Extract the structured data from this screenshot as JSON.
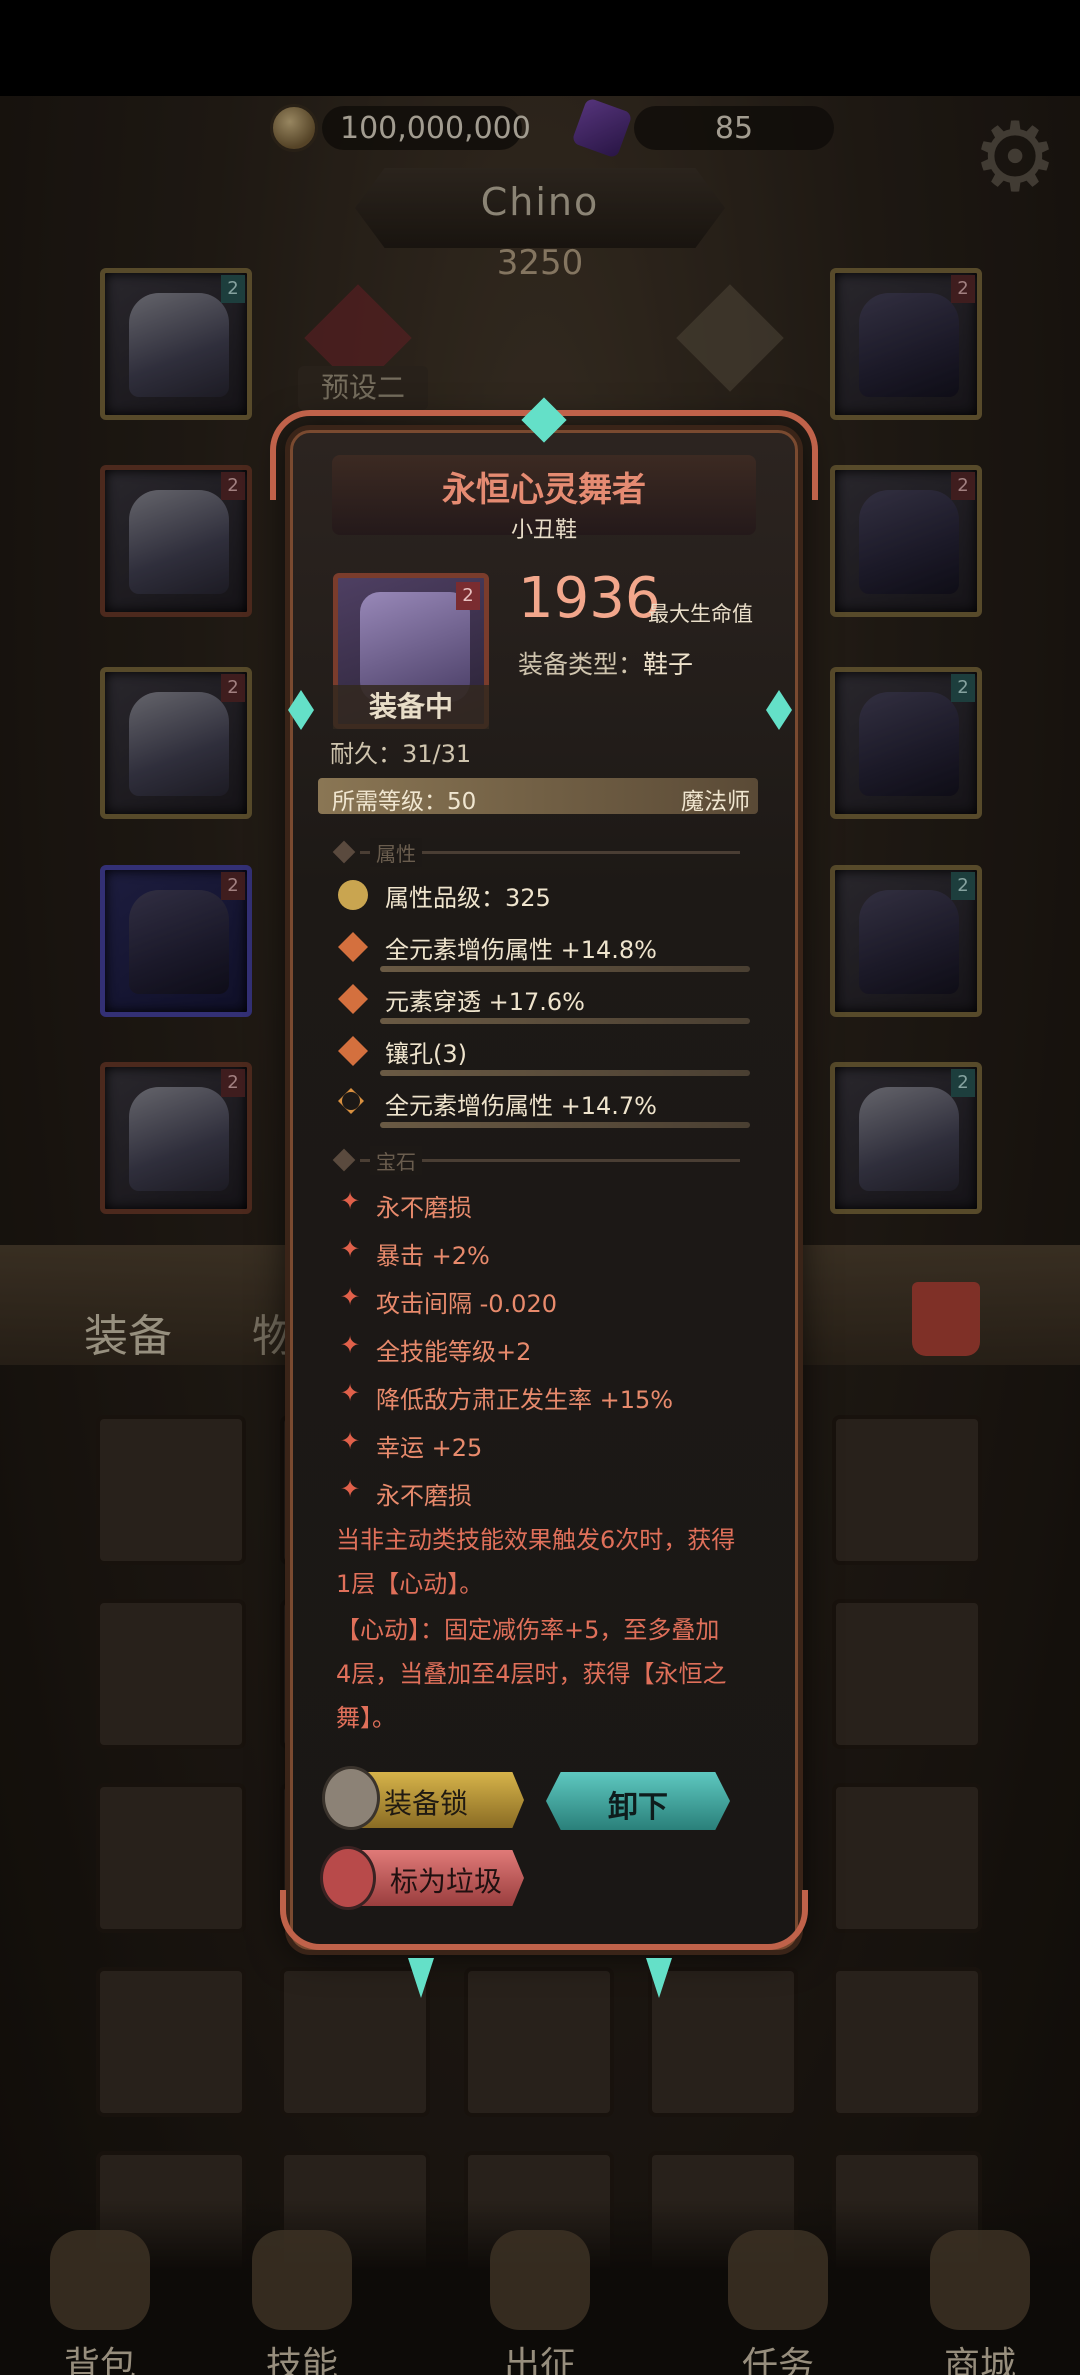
{
  "currency": {
    "gold": "100,000,000",
    "gems": "85"
  },
  "character": {
    "name": "Chino",
    "power": "3250",
    "preset": "预设二"
  },
  "tabs": {
    "equip": "装备",
    "items": "物品"
  },
  "item": {
    "name": "永恒心灵舞者",
    "subtitle": "小丑鞋",
    "tier_tag": "2",
    "status": "装备中",
    "main_stat_value": "1936",
    "main_stat_label": "最大生命值",
    "type_label": "装备类型：",
    "type_value": "鞋子",
    "durability": "耐久：31/31",
    "required_level": "所需等级：50",
    "required_class": "魔法师",
    "section_attr": "属性",
    "section_gem": "宝石",
    "attributes": [
      "属性品级：325",
      "全元素增伤属性 +14.8%",
      "元素穿透 +17.6%",
      "镶孔(3)",
      "全元素增伤属性 +14.7%"
    ],
    "gem_effects": [
      "永不磨损",
      "暴击 +2%",
      "攻击间隔 -0.020",
      "全技能等级+2",
      "降低敌方肃正发生率 +15%",
      "幸运 +25",
      "永不磨损"
    ],
    "description": [
      "当非主动类技能效果触发6次时，获得",
      "1层【心动】。",
      "【心动】：固定减伤率+5，至多叠加",
      "4层，当叠加至4层时，获得【永恒之",
      "舞】。"
    ]
  },
  "buttons": {
    "lock": "装备锁",
    "unequip": "卸下",
    "junk": "标为垃圾"
  },
  "nav": [
    "背包",
    "技能",
    "出征",
    "任务",
    "商城"
  ],
  "colors": {
    "title": "#e58b72",
    "gem_text": "#e88a6c",
    "accent_teal": "#64e0c8"
  }
}
